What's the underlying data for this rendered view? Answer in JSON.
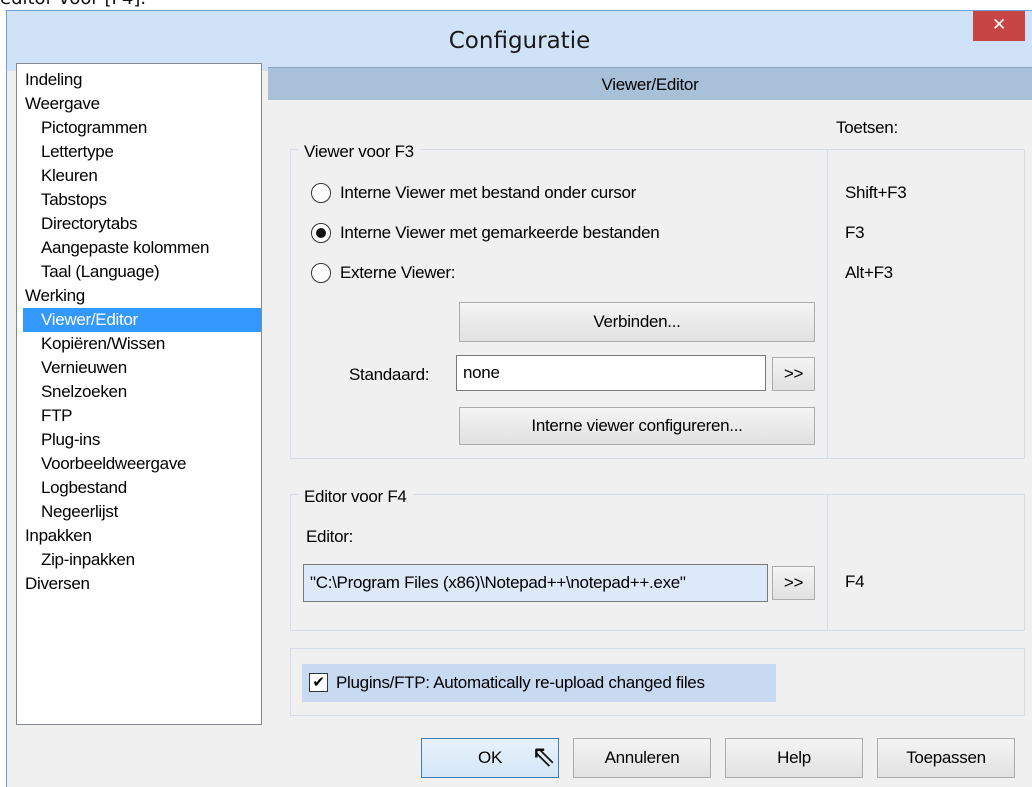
{
  "caption_fragment": "editor voor [F4].",
  "window": {
    "title": "Configuratie",
    "close_glyph": "✕"
  },
  "tree": {
    "items": [
      {
        "label": "Indeling",
        "level": 0
      },
      {
        "label": "Weergave",
        "level": 0
      },
      {
        "label": "Pictogrammen",
        "level": 1
      },
      {
        "label": "Lettertype",
        "level": 1
      },
      {
        "label": "Kleuren",
        "level": 1
      },
      {
        "label": "Tabstops",
        "level": 1
      },
      {
        "label": "Directorytabs",
        "level": 1
      },
      {
        "label": "Aangepaste kolommen",
        "level": 1
      },
      {
        "label": "Taal (Language)",
        "level": 1
      },
      {
        "label": "Werking",
        "level": 0
      },
      {
        "label": "Viewer/Editor",
        "level": 1,
        "selected": true
      },
      {
        "label": "Kopiëren/Wissen",
        "level": 1
      },
      {
        "label": "Vernieuwen",
        "level": 1
      },
      {
        "label": "Snelzoeken",
        "level": 1
      },
      {
        "label": "FTP",
        "level": 1
      },
      {
        "label": "Plug-ins",
        "level": 1
      },
      {
        "label": "Voorbeeldweergave",
        "level": 1
      },
      {
        "label": "Logbestand",
        "level": 1
      },
      {
        "label": "Negeerlijst",
        "level": 1
      },
      {
        "label": "Inpakken",
        "level": 0
      },
      {
        "label": "Zip-inpakken",
        "level": 1
      },
      {
        "label": "Diversen",
        "level": 0
      }
    ]
  },
  "section": {
    "title": "Viewer/Editor",
    "keys_label": "Toetsen:"
  },
  "viewer_group": {
    "title": "Viewer voor F3",
    "radios": [
      {
        "label": "Interne Viewer met bestand onder cursor",
        "key": "Shift+F3",
        "checked": false
      },
      {
        "label": "Interne Viewer met gemarkeerde bestanden",
        "key": "F3",
        "checked": true
      },
      {
        "label": "Externe Viewer:",
        "key": "Alt+F3",
        "checked": false
      }
    ],
    "connect_button": "Verbinden...",
    "standard_label": "Standaard:",
    "standard_value": "none",
    "browse_button": ">>",
    "config_button": "Interne viewer configureren..."
  },
  "editor_group": {
    "title": "Editor voor F4",
    "editor_label": "Editor:",
    "editor_value": "\"C:\\Program Files (x86)\\Notepad++\\notepad++.exe\"",
    "browse_button": ">>",
    "key": "F4"
  },
  "plugins": {
    "label": "Plugins/FTP: Automatically re-upload changed files",
    "checked": true,
    "check_glyph": "✔"
  },
  "buttons": {
    "ok": "OK",
    "cancel": "Annuleren",
    "help": "Help",
    "apply": "Toepassen"
  },
  "cursor_glyph": "⇖"
}
